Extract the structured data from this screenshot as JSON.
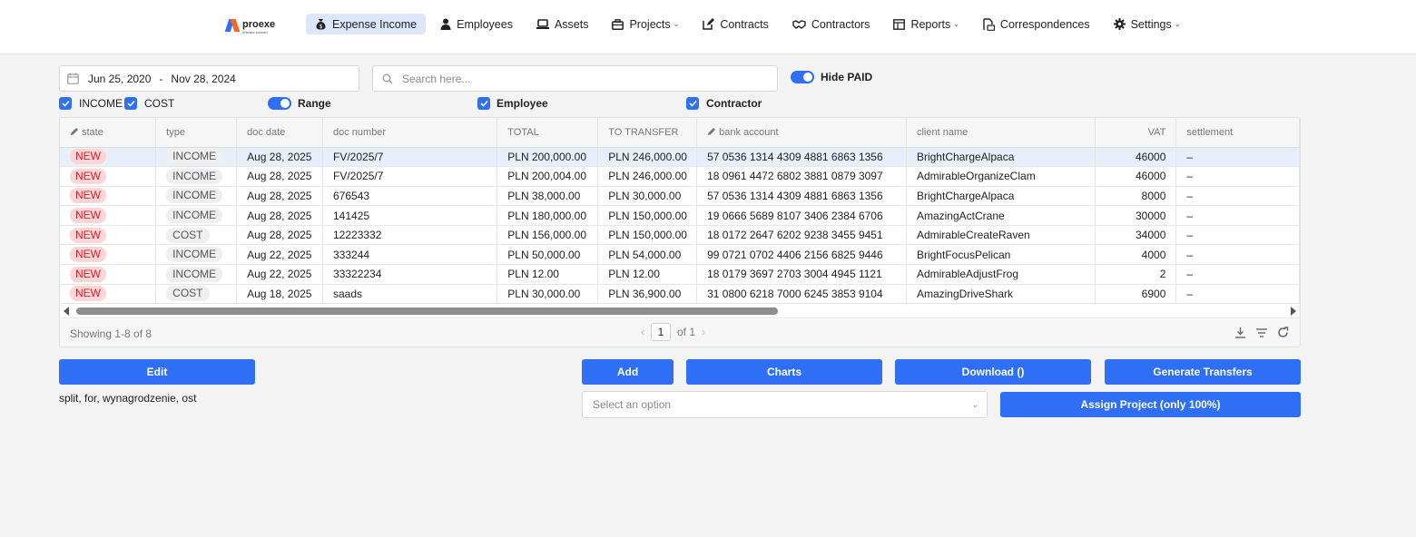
{
  "logo": {
    "name": "proexe",
    "tagline": "Wreaks smooth"
  },
  "nav": {
    "items": [
      {
        "label": "Expense Income",
        "icon": "money-bag-icon",
        "active": true,
        "dropdown": false
      },
      {
        "label": "Employees",
        "icon": "person-icon",
        "active": false,
        "dropdown": false
      },
      {
        "label": "Assets",
        "icon": "laptop-icon",
        "active": false,
        "dropdown": false
      },
      {
        "label": "Projects",
        "icon": "briefcase-icon",
        "active": false,
        "dropdown": true
      },
      {
        "label": "Contracts",
        "icon": "edit-document-icon",
        "active": false,
        "dropdown": false
      },
      {
        "label": "Contractors",
        "icon": "handshake-icon",
        "active": false,
        "dropdown": false
      },
      {
        "label": "Reports",
        "icon": "report-icon",
        "active": false,
        "dropdown": true
      },
      {
        "label": "Correspondences",
        "icon": "mail-document-icon",
        "active": false,
        "dropdown": false
      },
      {
        "label": "Settings",
        "icon": "gear-icon",
        "active": false,
        "dropdown": true
      }
    ]
  },
  "filters": {
    "date_from": "Jun 25, 2020",
    "date_sep": "-",
    "date_to": "Nov 28, 2024",
    "search_placeholder": "Search here...",
    "search_value": "",
    "hide_paid_label": "Hide PAID",
    "hide_paid": true,
    "income_label": "INCOME",
    "income_checked": true,
    "cost_label": "COST",
    "cost_checked": true,
    "range_label": "Range",
    "range_on": true,
    "employee_label": "Employee",
    "employee_checked": true,
    "contractor_label": "Contractor",
    "contractor_checked": true
  },
  "table": {
    "columns": [
      "state",
      "type",
      "doc date",
      "doc number",
      "TOTAL",
      "TO TRANSFER",
      "bank account",
      "client name",
      "VAT",
      "settlement"
    ],
    "rows": [
      {
        "state": "NEW",
        "type": "INCOME",
        "doc_date": "Aug 28, 2025",
        "doc_number": "FV/2025/7",
        "total": "PLN 200,000.00",
        "to_transfer": "PLN 246,000.00",
        "bank_account": "57 0536 1314 4309 4881 6863 1356",
        "client_name": "BrightChargeAlpaca",
        "vat": "46000",
        "settlement": "–"
      },
      {
        "state": "NEW",
        "type": "INCOME",
        "doc_date": "Aug 28, 2025",
        "doc_number": "FV/2025/7",
        "total": "PLN 200,004.00",
        "to_transfer": "PLN 246,000.00",
        "bank_account": "18 0961 4472 6802 3881 0879 3097",
        "client_name": "AdmirableOrganizeClam",
        "vat": "46000",
        "settlement": "–"
      },
      {
        "state": "NEW",
        "type": "INCOME",
        "doc_date": "Aug 28, 2025",
        "doc_number": "676543",
        "total": "PLN 38,000.00",
        "to_transfer": "PLN 30,000.00",
        "bank_account": "57 0536 1314 4309 4881 6863 1356",
        "client_name": "BrightChargeAlpaca",
        "vat": "8000",
        "settlement": "–"
      },
      {
        "state": "NEW",
        "type": "INCOME",
        "doc_date": "Aug 28, 2025",
        "doc_number": "141425",
        "total": "PLN 180,000.00",
        "to_transfer": "PLN 150,000.00",
        "bank_account": "19 0666 5689 8107 3406 2384 6706",
        "client_name": "AmazingActCrane",
        "vat": "30000",
        "settlement": "–"
      },
      {
        "state": "NEW",
        "type": "COST",
        "doc_date": "Aug 28, 2025",
        "doc_number": "12223332",
        "total": "PLN 156,000.00",
        "to_transfer": "PLN 150,000.00",
        "bank_account": "18 0172 2647 6202 9238 3455 9451",
        "client_name": "AdmirableCreateRaven",
        "vat": "34000",
        "settlement": "–"
      },
      {
        "state": "NEW",
        "type": "INCOME",
        "doc_date": "Aug 22, 2025",
        "doc_number": "333244",
        "total": "PLN 50,000.00",
        "to_transfer": "PLN 54,000.00",
        "bank_account": "99 0721 0702 4406 2156 6825 9446",
        "client_name": "BrightFocusPelican",
        "vat": "4000",
        "settlement": "–"
      },
      {
        "state": "NEW",
        "type": "INCOME",
        "doc_date": "Aug 22, 2025",
        "doc_number": "33322234",
        "total": "PLN 12.00",
        "to_transfer": "PLN 12.00",
        "bank_account": "18 0179 3697 2703 3004 4945 1121",
        "client_name": "AdmirableAdjustFrog",
        "vat": "2",
        "settlement": "–"
      },
      {
        "state": "NEW",
        "type": "COST",
        "doc_date": "Aug 18, 2025",
        "doc_number": "saads",
        "total": "PLN 30,000.00",
        "to_transfer": "PLN 36,900.00",
        "bank_account": "31 0800 6218 7000 6245 3853 9104",
        "client_name": "AmazingDriveShark",
        "vat": "6900",
        "settlement": "–"
      }
    ],
    "showing": "Showing 1-8 of 8",
    "page": "1",
    "page_of": "of 1",
    "prev": "‹",
    "next": "›"
  },
  "actions": {
    "edit": "Edit",
    "add": "Add",
    "charts": "Charts",
    "download": "Download ()",
    "generate_transfers": "Generate Transfers",
    "assign_project": "Assign Project (only 100%)",
    "select_placeholder": "Select an option",
    "note": "split, for, wynagrodzenie, ost"
  },
  "colors": {
    "accent": "#2f6ff5",
    "new_badge_bg": "#fbd6d6",
    "new_badge_text": "#d61e2a",
    "selected_row": "#e9eefb",
    "page_bg": "#f3f3f3"
  }
}
